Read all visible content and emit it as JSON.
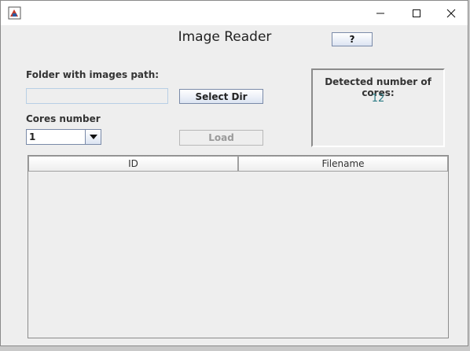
{
  "window": {
    "title": "Image Reader",
    "help_label": "?"
  },
  "folder": {
    "label": "Folder with images path:",
    "value": "",
    "select_label": "Select Dir"
  },
  "cores": {
    "label": "Cores number",
    "selected": "1",
    "load_label": "Load"
  },
  "detected": {
    "label": "Detected number of cores:",
    "value": "12"
  },
  "table": {
    "columns": [
      "ID",
      "Filename"
    ],
    "rows": []
  },
  "colors": {
    "accent_value": "#2e7d86",
    "button_border": "#7a8aa8"
  },
  "icons": {
    "app": "java-app-icon",
    "minimize": "minimize-icon",
    "maximize": "maximize-icon",
    "close": "close-icon",
    "dropdown": "chevron-down-icon"
  }
}
